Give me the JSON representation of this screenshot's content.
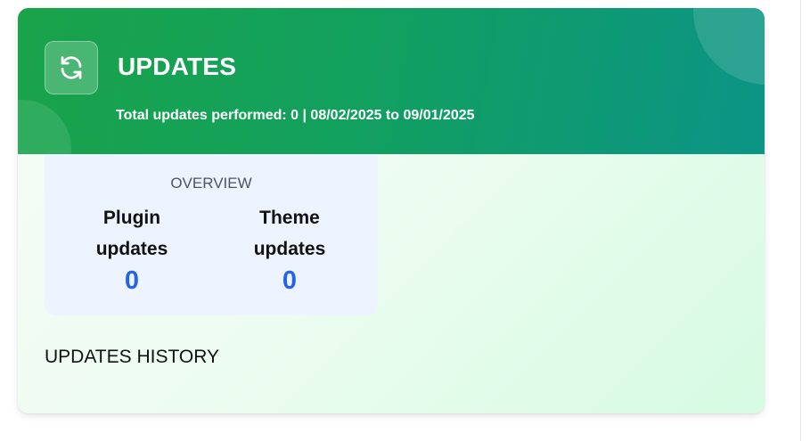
{
  "header": {
    "icon": "refresh-icon",
    "title": "UPDATES",
    "subtitle": "Total updates performed: 0 | 08/02/2025 to 09/01/2025"
  },
  "overview": {
    "label": "OVERVIEW",
    "stats": [
      {
        "label": "Plugin updates",
        "value": "0"
      },
      {
        "label": "Theme updates",
        "value": "0"
      }
    ]
  },
  "history": {
    "title": "UPDATES HISTORY"
  },
  "colors": {
    "header_gradient_start": "#1aa34a",
    "header_gradient_end": "#0c9486",
    "stat_value": "#2563eb",
    "overview_bg": "#eef4ff"
  }
}
